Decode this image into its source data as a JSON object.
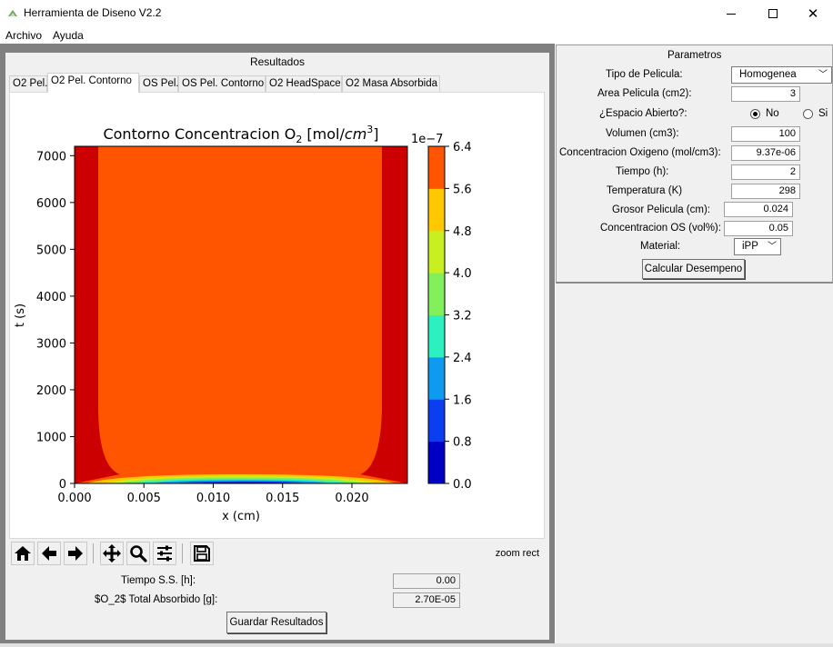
{
  "window": {
    "title": "Herramienta de Diseno V2.2",
    "minimize": "–",
    "close": "✕"
  },
  "menu": {
    "items": [
      "Archivo",
      "Ayuda"
    ]
  },
  "results": {
    "title": "Resultados",
    "tabs": [
      "O2 Pel.",
      "O2 Pel. Contorno",
      "OS Pel.",
      "OS Pel. Contorno",
      "O2 HeadSpace",
      "O2 Masa Absorbida"
    ],
    "active_tab": "O2 Pel. Contorno"
  },
  "chart_data": {
    "type": "heatmap",
    "title_prefix": "Contorno Concentracion O",
    "title_sub": "2",
    "title_open": " [mol/",
    "title_unit": "cm",
    "title_sup": "3",
    "title_close": "]",
    "xlabel": "x (cm)",
    "ylabel": "t (s)",
    "x_ticks": [
      "0.000",
      "0.005",
      "0.010",
      "0.015",
      "0.020"
    ],
    "x_tick_values": [
      0.0,
      0.005,
      0.01,
      0.015,
      0.02
    ],
    "xlim": [
      0.0,
      0.024
    ],
    "y_ticks": [
      "0",
      "1000",
      "2000",
      "3000",
      "4000",
      "5000",
      "6000",
      "7000"
    ],
    "y_tick_values": [
      0,
      1000,
      2000,
      3000,
      4000,
      5000,
      6000,
      7000
    ],
    "ylim": [
      0,
      7200
    ],
    "colorbar": {
      "offset_label": "1e−7",
      "tick_labels": [
        "0.0",
        "0.8",
        "1.6",
        "2.4",
        "3.2",
        "4.0",
        "4.8",
        "5.6",
        "6.4"
      ],
      "tick_values": [
        0.0,
        0.8,
        1.6,
        2.4,
        3.2,
        4.0,
        4.8,
        5.6,
        6.4
      ],
      "level_colors": [
        "#0000c4",
        "#0a3ef0",
        "#0e9af0",
        "#2df0c0",
        "#82f05a",
        "#c8f020",
        "#ffc800",
        "#ff5500",
        "#cc0000"
      ]
    }
  },
  "toolbar": {
    "buttons": [
      "home-icon",
      "back-icon",
      "forward-icon",
      "pan-icon",
      "zoom-icon",
      "configure-subplots-icon",
      "save-icon"
    ],
    "mode_label": "zoom rect"
  },
  "summary": {
    "ss_time_label": "Tiempo S.S. [h]:",
    "ss_time_value": "0.00",
    "absorbed_label": "$O_2$ Total Absorbido [g]:",
    "absorbed_value": "2.70E-05",
    "save_button": "Guardar Resultados"
  },
  "params": {
    "title": "Parametros",
    "film_type_label": "Tipo de Pelicula:",
    "film_type_value": "Homogenea",
    "area_label": "Area Pelicula (cm2):",
    "area_value": "3",
    "open_space_label": "¿Espacio Abierto?:",
    "radio_no": "No",
    "radio_si": "Si",
    "volume_label": "Volumen (cm3):",
    "volume_value": "100",
    "oxygen_conc_label": "Concentracion Oxigeno (mol/cm3):",
    "oxygen_conc_value": "9.37e-06",
    "time_label": "Tiempo (h):",
    "time_value": "2",
    "temperature_label": "Temperatura (K)",
    "temperature_value": "298",
    "thickness_label": "Grosor Pelicula (cm):",
    "thickness_value": "0.024",
    "os_conc_label": "Concentracion OS (vol%):",
    "os_conc_value": "0.05",
    "material_label": "Material:",
    "material_value": "iPP",
    "calc_button": "Calcular Desempeno"
  }
}
